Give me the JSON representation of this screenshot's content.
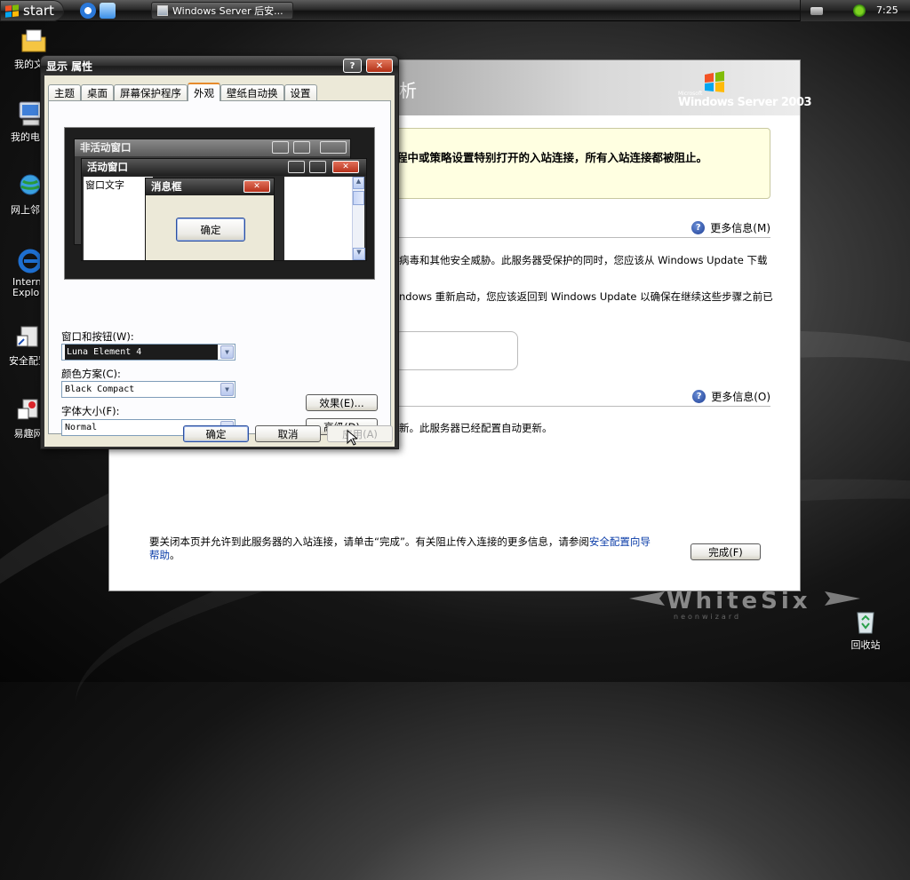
{
  "taskbar": {
    "start_label": "start",
    "task_button_label": "Windows Server 后安...",
    "clock": "7:25"
  },
  "desktop": {
    "icons": [
      {
        "label": "我的文档",
        "icon": "my-documents-icon"
      },
      {
        "label": "我的电脑",
        "icon": "my-computer-icon"
      },
      {
        "label": "网上邻居",
        "icon": "network-icon"
      },
      {
        "label": "Internet Explorer",
        "icon": "internet-explorer-icon"
      },
      {
        "label": "安全配置",
        "icon": "security-config-icon"
      },
      {
        "label": "易趣网",
        "icon": "ebay-icon"
      },
      {
        "label": "回收站",
        "icon": "recycle-bin-icon"
      }
    ],
    "brand_text": "WhiteSix",
    "brand_sub": "neonwizard"
  },
  "wizard": {
    "header_title": "析",
    "logo_ms": "Microsoft",
    "logo_name": "Windows Server 2003",
    "warning_text": "程中或策略设置特别打开的入站连接，所有入站连接都被阻止。",
    "more_info_1": "更多信息(M)",
    "line_1": "病毒和其他安全威胁。此服务器受保护的同时，您应该从 Windows Update 下载",
    "line_2": "ndows 重新启动，您应该返回到 Windows Update 以确保在继续这些步骤之前已",
    "more_info_2": "更多信息(O)",
    "line_3": "新。此服务器已经配置自动更新。",
    "footer_text": "要关闭本页并允许到此服务器的入站连接，请单击“完成”。有关阻止传入连接的更多信息，请参阅",
    "footer_link": "安全配置向导",
    "footer_link2": "帮助",
    "footer_end": "。",
    "finish_button": "完成(F)"
  },
  "dialog": {
    "title": "显示 属性",
    "help_btn": "?",
    "close_btn": "✕",
    "tabs": [
      "主题",
      "桌面",
      "屏幕保护程序",
      "外观",
      "壁纸自动换",
      "设置"
    ],
    "active_tab": "外观",
    "preview": {
      "inactive_title": "非活动窗口",
      "active_title": "活动窗口",
      "window_text": "窗口文字",
      "msgbox_title": "消息框",
      "msgbox_ok": "确定"
    },
    "windows_buttons_label": "窗口和按钮(W):",
    "windows_buttons_value": "Luna Element 4",
    "color_scheme_label": "颜色方案(C):",
    "color_scheme_value": "Black Compact",
    "font_size_label": "字体大小(F):",
    "font_size_value": "Normal",
    "effects_button": "效果(E)...",
    "advanced_button": "高级(D)",
    "ok_button": "确定",
    "cancel_button": "取消",
    "apply_button": "应用(A)"
  }
}
